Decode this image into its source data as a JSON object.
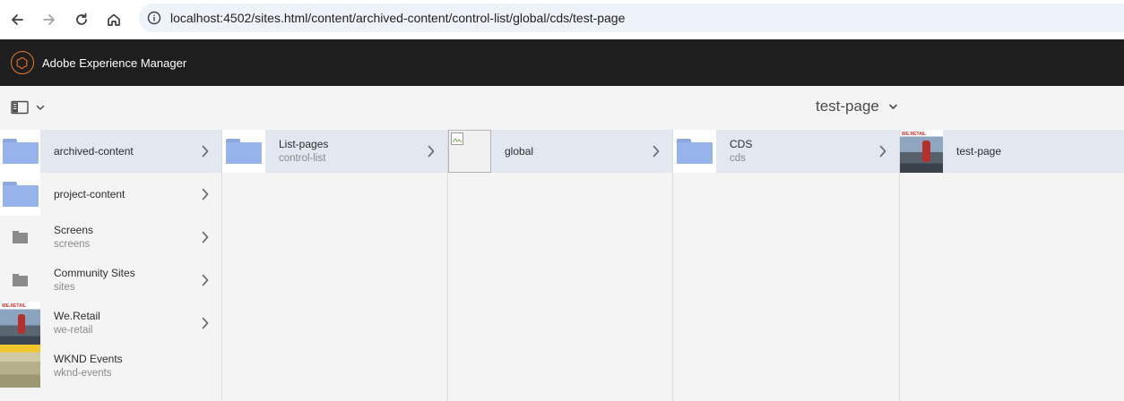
{
  "browser": {
    "url": "localhost:4502/sites.html/content/archived-content/control-list/global/cds/test-page"
  },
  "header": {
    "app_title": "Adobe Experience Manager"
  },
  "action_bar": {
    "page_title": "test-page"
  },
  "columns": [
    {
      "items": [
        {
          "title": "archived-content",
          "subtitle": "",
          "thumb": "folder-blue",
          "selected": true,
          "has_children": true
        },
        {
          "title": "project-content",
          "subtitle": "",
          "thumb": "folder-blue",
          "selected": false,
          "has_children": true
        },
        {
          "title": "Screens",
          "subtitle": "screens",
          "thumb": "folder-grey",
          "selected": false,
          "has_children": true
        },
        {
          "title": "Community Sites",
          "subtitle": "sites",
          "thumb": "folder-grey",
          "selected": false,
          "has_children": true
        },
        {
          "title": "We.Retail",
          "subtitle": "we-retail",
          "thumb": "we-retail-photo",
          "selected": false,
          "has_children": true
        },
        {
          "title": "WKND Events",
          "subtitle": "wknd-events",
          "thumb": "wknd-photo",
          "selected": false,
          "has_children": false
        }
      ]
    },
    {
      "items": [
        {
          "title": "List-pages",
          "subtitle": "control-list",
          "thumb": "folder-blue",
          "selected": true,
          "has_children": true
        }
      ]
    },
    {
      "items": [
        {
          "title": "global",
          "subtitle": "",
          "thumb": "broken-image",
          "selected": true,
          "has_children": true
        }
      ]
    },
    {
      "items": [
        {
          "title": "CDS",
          "subtitle": "cds",
          "thumb": "folder-blue",
          "selected": true,
          "has_children": true
        }
      ]
    },
    {
      "items": [
        {
          "title": "test-page",
          "subtitle": "",
          "thumb": "test-page-photo",
          "selected": true,
          "has_children": false
        }
      ]
    }
  ],
  "thumb_labels": {
    "weretail": "WE.RETAIL",
    "testpage": "WE.RETAIL"
  },
  "colors": {
    "header_bg": "#1e1e1e",
    "selected_row": "#e3e8f0",
    "folder_blue": "#97b3eb",
    "logo_orange": "#e8772e"
  }
}
